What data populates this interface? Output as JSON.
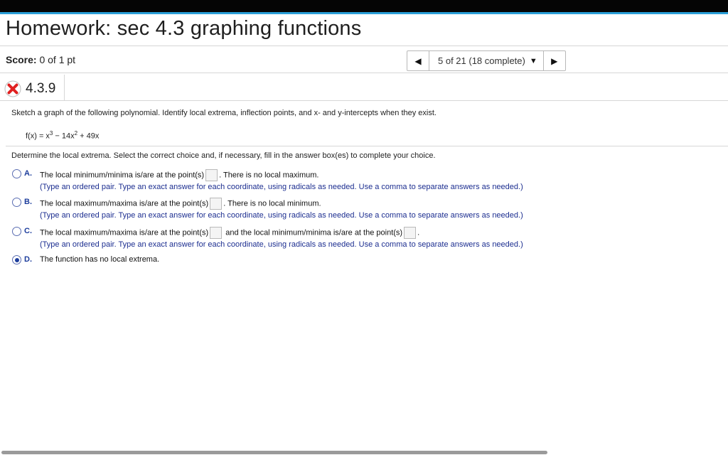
{
  "header": {
    "title": "Homework: sec 4.3 graphing functions"
  },
  "score": {
    "label": "Score:",
    "value": "0 of 1 pt"
  },
  "nav": {
    "prev": "◀",
    "next": "▶",
    "position": "5 of 21 (18 complete)",
    "caret": "▼"
  },
  "question": {
    "status_icon": "x-icon",
    "status_color": "#e02020",
    "number": "4.3.9",
    "prompt": "Sketch a graph of the following polynomial. Identify local extrema, inflection points, and x- and y-intercepts when they exist.",
    "formula": {
      "lhs": "f(x) = x",
      "exp1": "3",
      "mid": " − 14x",
      "exp2": "2",
      "rhs": " + 49x"
    },
    "instruction": "Determine the local extrema. Select the correct choice and, if necessary, fill in the answer box(es) to complete your choice."
  },
  "choices": [
    {
      "letter": "A.",
      "text_before": "The local minimum/minima is/are at the point(s)",
      "text_after": ". There is no local maximum.",
      "hint": "(Type an ordered pair. Type an exact answer for each coordinate, using radicals as needed. Use a comma to separate answers as needed.)",
      "selected": false
    },
    {
      "letter": "B.",
      "text_before": "The local maximum/maxima is/are at the point(s)",
      "text_after": ". There is no local minimum.",
      "hint": "(Type an ordered pair. Type an exact answer for each coordinate, using radicals as needed. Use a comma to separate answers as needed.)",
      "selected": false
    },
    {
      "letter": "C.",
      "text_before": "The local maximum/maxima is/are at the point(s)",
      "text_mid": "and the local minimum/minima is/are at the point(s)",
      "text_after": ".",
      "hint": "(Type an ordered pair. Type an exact answer for each coordinate, using radicals as needed. Use a comma to separate answers as needed.)",
      "selected": false
    },
    {
      "letter": "D.",
      "text_before": "The function has no local extrema.",
      "selected": true
    }
  ]
}
